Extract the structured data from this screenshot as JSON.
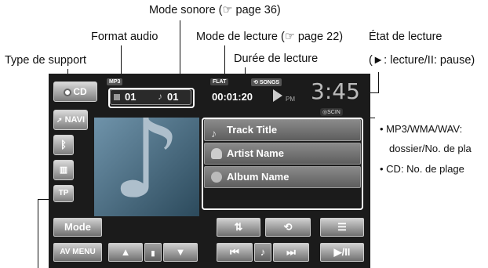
{
  "annotations": {
    "type_support": "Type de support",
    "format_audio": "Format audio",
    "mode_sonore": "Mode sonore (☞ page 36)",
    "mode_lecture": "Mode de lecture (☞ page 22)",
    "duree_lecture": "Durée de lecture",
    "etat_lecture": "État de lecture",
    "etat_lecture_detail": "(►: lecture/II: pause)",
    "folder_note_1": "MP3/WMA/WAV:",
    "folder_note_2": "dossier/No. de pla",
    "cd_note": "CD: No. de plage"
  },
  "screen": {
    "source_label": "CD",
    "navi_label": "NAVI",
    "tp_label": "TP",
    "format_badge": "MP3",
    "sound_badge": "FLAT",
    "repeat_badge": "SONGS",
    "folder_number": "01",
    "track_number": "01",
    "elapsed_time": "00:01:20",
    "clock_ampm": "PM",
    "clock_time": "3:45",
    "scin_badge": "SCIN",
    "track_title": "Track Title",
    "artist_name": "Artist Name",
    "album_name": "Album Name",
    "mode_button": "Mode",
    "av_menu_button": "AV MENU"
  },
  "colors": {
    "screen_bg": "#1b1b1b",
    "button_gradient_top": "#d9d9d9",
    "artwork_bg": "#4a6f86"
  }
}
